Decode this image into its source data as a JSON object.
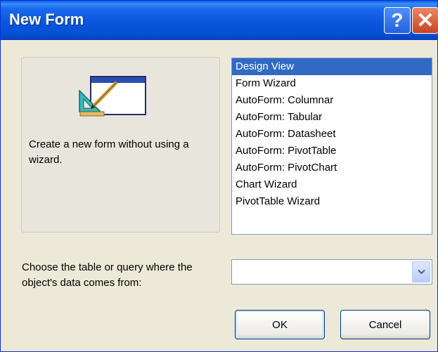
{
  "window": {
    "title": "New Form",
    "help_label": "?",
    "close_label": "✕"
  },
  "preview": {
    "description": "Create a new form without using a wizard."
  },
  "list": {
    "items": [
      "Design View",
      "Form Wizard",
      "AutoForm: Columnar",
      "AutoForm: Tabular",
      "AutoForm: Datasheet",
      "AutoForm: PivotTable",
      "AutoForm: PivotChart",
      "Chart Wizard",
      "PivotTable Wizard"
    ],
    "selected_index": 0
  },
  "source": {
    "label": "Choose the table or query where the object's data comes from:",
    "value": ""
  },
  "buttons": {
    "ok": "OK",
    "cancel": "Cancel"
  },
  "colors": {
    "titlebar": "#0a55dc",
    "selection": "#316ac5",
    "face": "#ece9d8"
  },
  "icons": {
    "wizard": "design-view-icon",
    "dropdown": "chevron-down-icon"
  }
}
